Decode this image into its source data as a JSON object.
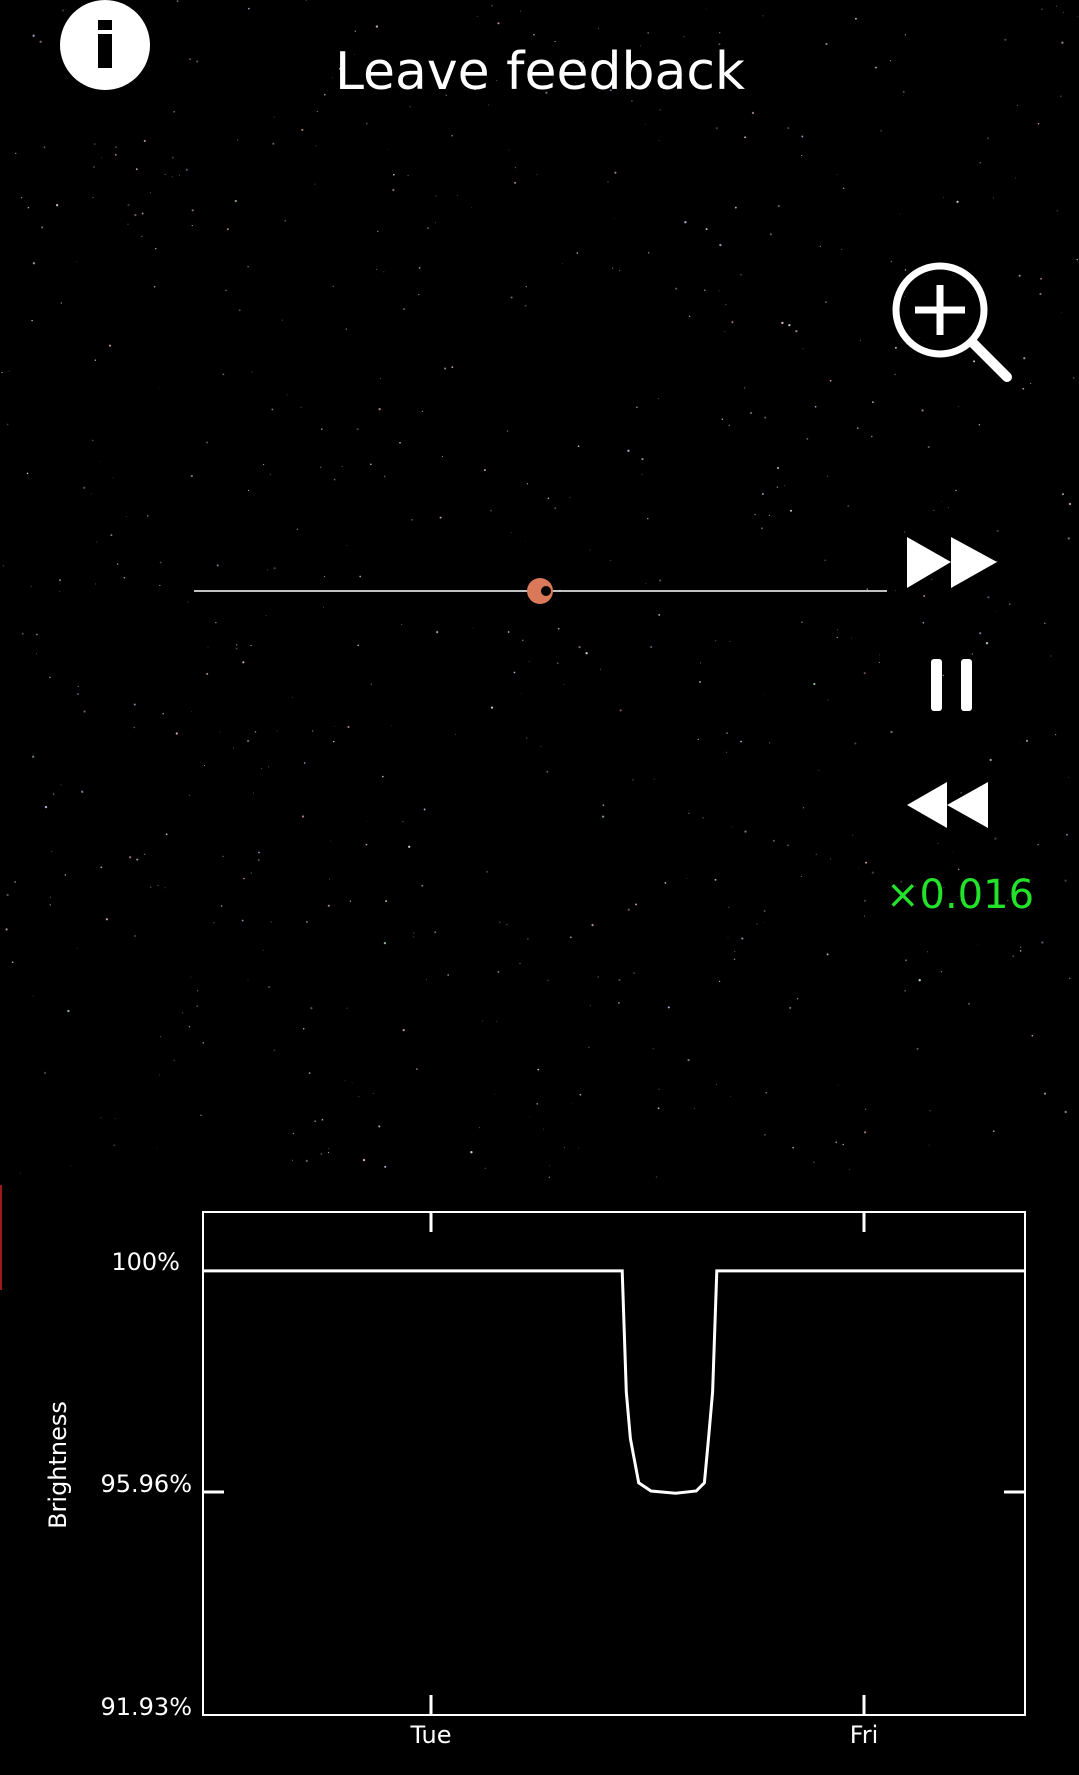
{
  "header": {
    "feedback_label": "Leave feedback"
  },
  "icons": {
    "info": "info-icon",
    "zoom_in": "zoom-in-icon",
    "fast_forward": "fast-forward-icon",
    "pause": "pause-icon",
    "rewind": "rewind-icon"
  },
  "playback": {
    "speed_label": "×0.016"
  },
  "colors": {
    "background": "#000000",
    "speed_text": "#22e32a",
    "planet": "#d9795a",
    "curve": "#ffffff"
  },
  "chart_data": {
    "type": "line",
    "title": "",
    "xlabel": "",
    "ylabel": "Brightness",
    "y_ticks": [
      "100%",
      "95.96%",
      "91.93%"
    ],
    "x_ticks": [
      "Tue",
      "Fri"
    ],
    "ylim": [
      91.93,
      101.07
    ],
    "series": [
      {
        "x": [
          0.0,
          0.51,
          0.515,
          0.52,
          0.53,
          0.545,
          0.575,
          0.6,
          0.61,
          0.615,
          0.62,
          0.625,
          1.0
        ],
        "values": [
          100,
          100,
          97.8,
          96.95,
          96.15,
          96.0,
          95.96,
          96.0,
          96.15,
          96.95,
          97.8,
          100,
          100
        ]
      }
    ]
  }
}
